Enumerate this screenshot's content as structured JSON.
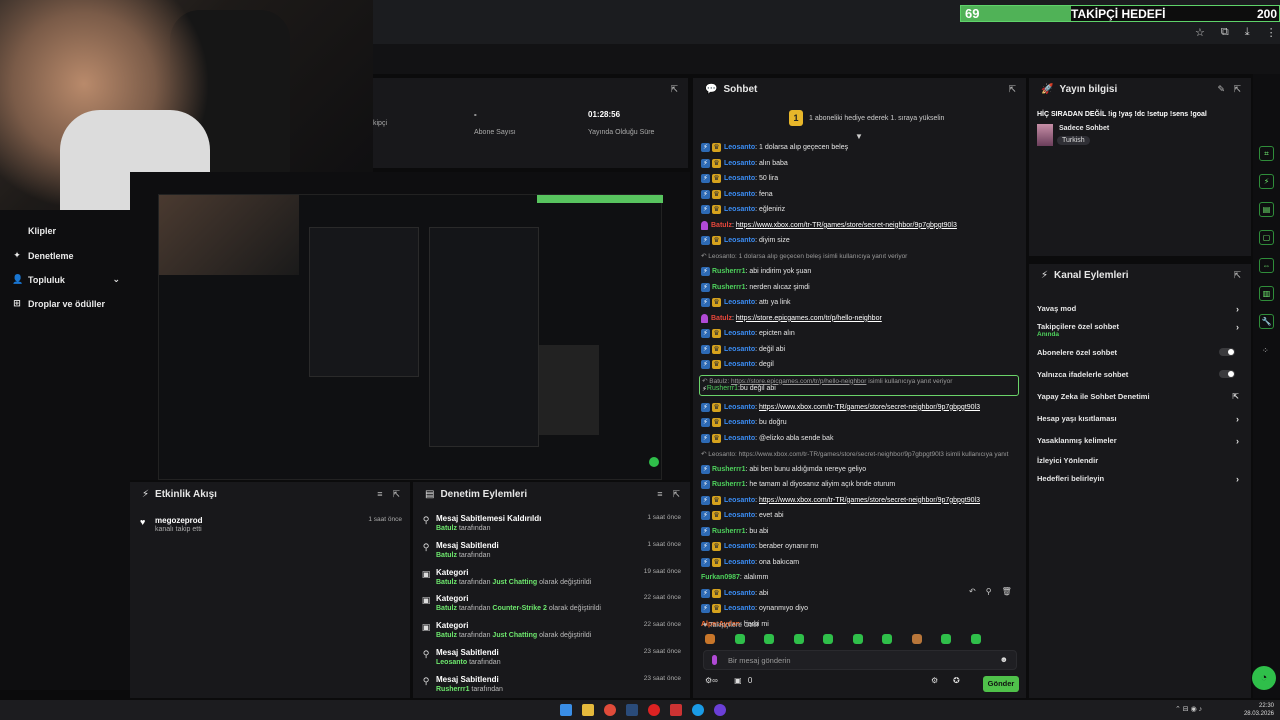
{
  "goal": {
    "current": "69",
    "title": "TAKİPÇİ HEDEFİ",
    "target": "200",
    "progress": 0.345
  },
  "sidebar": {
    "items": [
      {
        "label": "Klipler",
        "icon": ""
      },
      {
        "label": "Denetleme",
        "icon": "✦"
      },
      {
        "label": "Topluluk",
        "icon": "👤"
      },
      {
        "label": "Droplar ve ödüller",
        "icon": "⊞"
      }
    ]
  },
  "stats": {
    "cells": [
      {
        "value": "",
        "label": "kipçi"
      },
      {
        "value": "-",
        "label": "Abone Sayısı"
      },
      {
        "value": "01:28:56",
        "label": "Yayında Olduğu Süre"
      }
    ]
  },
  "activity": {
    "title": "Etkinlik Akışı",
    "items": [
      {
        "name": "megozeprod",
        "desc": "kanalı takip etti",
        "time": "1 saat önce"
      }
    ]
  },
  "moderation": {
    "title": "Denetim Eylemleri",
    "items": [
      {
        "title": "Mesaj Sabitlemesi Kaldırıldı",
        "user": "Batulz",
        "rest": " tarafından",
        "time": "1 saat önce"
      },
      {
        "title": "Mesaj Sabitlendi",
        "user": "Batulz",
        "rest": " tarafından",
        "time": "1 saat önce"
      },
      {
        "title": "Kategori",
        "user": "Batulz",
        "rest": " tarafından ",
        "cat": "Just Chatting",
        "tail": " olarak değiştirildi",
        "time": "19 saat önce"
      },
      {
        "title": "Kategori",
        "user": "Batulz",
        "rest": " tarafından ",
        "cat": "Counter-Strike 2",
        "tail": " olarak değiştirildi",
        "time": "22 saat önce"
      },
      {
        "title": "Kategori",
        "user": "Batulz",
        "rest": " tarafından ",
        "cat": "Just Chatting",
        "tail": " olarak değiştirildi",
        "time": "22 saat önce"
      },
      {
        "title": "Mesaj Sabitlendi",
        "user": "Leosanto",
        "rest": " tarafından",
        "time": "23 saat önce"
      },
      {
        "title": "Mesaj Sabitlendi",
        "user": "Rusherrr1",
        "rest": " tarafından",
        "time": "23 saat önce"
      }
    ]
  },
  "chat": {
    "title": "Sohbet",
    "hype_text": "1 aboneliki hediye ederek 1. sıraya yükselin",
    "hype_rank": "1",
    "input_placeholder": "Bir mesaj gönderin",
    "pinned_label": "Takipçilere Özel",
    "points": "0",
    "send_label": "Gönder",
    "messages": [
      {
        "user": "Leosanto",
        "color": "blue",
        "badges": 2,
        "text": "1 dolarsa alıp geçecen beleş"
      },
      {
        "user": "Leosanto",
        "color": "blue",
        "badges": 2,
        "text": "alın baba"
      },
      {
        "user": "Leosanto",
        "color": "blue",
        "badges": 2,
        "text": "50 lira"
      },
      {
        "user": "Leosanto",
        "color": "blue",
        "badges": 2,
        "text": "fena"
      },
      {
        "user": "Leosanto",
        "color": "blue",
        "badges": 2,
        "text": "eğleniriz"
      },
      {
        "user": "Batulz",
        "color": "red",
        "badges": "p",
        "link": "https://www.xbox.com/tr-TR/games/store/secret-neighbor/9p7gbpgt90l3"
      },
      {
        "user": "Leosanto",
        "color": "blue",
        "badges": 2,
        "text": "diyim size"
      },
      {
        "reply": "Leosanto: 1 dolarsa alıp geçecen beleş isimli kullanıcıya yanıt veriyor"
      },
      {
        "user": "Rusherrr1",
        "color": "green",
        "badges": 1,
        "text": "abi indirim yok şuan"
      },
      {
        "user": "Rusherrr1",
        "color": "green",
        "badges": 1,
        "text": "nerden alıcaz şimdi"
      },
      {
        "user": "Leosanto",
        "color": "blue",
        "badges": 2,
        "text": "attı ya link"
      },
      {
        "user": "Batulz",
        "color": "red",
        "badges": "p",
        "link": "https://store.epicgames.com/tr/p/hello-neighbor"
      },
      {
        "user": "Leosanto",
        "color": "blue",
        "badges": 2,
        "text": "epicten alın"
      },
      {
        "user": "Leosanto",
        "color": "blue",
        "badges": 2,
        "text": "değil abi"
      },
      {
        "user": "Leosanto",
        "color": "blue",
        "badges": 2,
        "text": "degil"
      },
      {
        "highlight": true,
        "reply_user": "Batulz",
        "reply_link": "https://store.epicgames.com/tr/p/hello-neighbor",
        "reply_tail": " isimli kullanıcıya yanıt veriyor",
        "user": "Rusherrr1",
        "color": "green",
        "badges": 1,
        "text": "bu değil abi"
      },
      {
        "user": "Leosanto",
        "color": "blue",
        "badges": 2,
        "link": "https://www.xbox.com/tr-TR/games/store/secret-neighbor/9p7gbpgt90l3"
      },
      {
        "user": "Leosanto",
        "color": "blue",
        "badges": 2,
        "text": "bu doğru"
      },
      {
        "user": "Leosanto",
        "color": "blue",
        "badges": 2,
        "text": "@elizko abla sende bak"
      },
      {
        "reply": "Leosanto: https://www.xbox.com/tr-TR/games/store/secret-neighbor/9p7gbpgt90l3 isimli kullanıcıya yanıt"
      },
      {
        "user": "Rusherrr1",
        "color": "green",
        "badges": 1,
        "text": "abi ben bunu aldığımda nereye geliyo"
      },
      {
        "user": "Rusherrr1",
        "color": "green",
        "badges": 1,
        "text": "he tamam al diyosanız aliyim açık bnde oturum"
      },
      {
        "user": "Leosanto",
        "color": "blue",
        "badges": 2,
        "link": "https://www.xbox.com/tr-TR/games/store/secret-neighbor/9p7gbpgt90l3"
      },
      {
        "user": "Leosanto",
        "color": "blue",
        "badges": 2,
        "text": "evet abi"
      },
      {
        "user": "Rusherrr1",
        "color": "green",
        "badges": 1,
        "text": "bu abi"
      },
      {
        "user": "Leosanto",
        "color": "blue",
        "badges": 2,
        "text": "beraber oynanır mı"
      },
      {
        "user": "Leosanto",
        "color": "blue",
        "badges": 2,
        "text": "ona bakıcam"
      },
      {
        "user": "Furkan0987",
        "color": "green",
        "badges": 0,
        "text": "alalımm"
      },
      {
        "user": "Leosanto",
        "color": "blue",
        "badges": 2,
        "text": "abi"
      },
      {
        "user": "Leosanto",
        "color": "blue",
        "badges": 2,
        "text": "oynanmıyo diyo"
      },
      {
        "user": "AlperAydan",
        "color": "orange",
        "badges": 0,
        "text": "harbi mi"
      }
    ]
  },
  "stream_info": {
    "title": "Yayın bilgisi",
    "stream_title": "HİÇ SIRADAN DEĞİL !ig !yaş !dc !setup !sens !goal",
    "category": "Sadece Sohbet",
    "language": "Turkish"
  },
  "channel_actions": {
    "title": "Kanal Eylemleri",
    "rows": [
      {
        "label": "Yavaş mod",
        "sub": "",
        "control": "chevron"
      },
      {
        "label": "Takipçilere özel sohbet",
        "sub": "Anında",
        "control": "chevron"
      },
      {
        "label": "Abonelere özel sohbet",
        "sub": "",
        "control": "toggle"
      },
      {
        "label": "Yalnızca ifadelerle sohbet",
        "sub": "",
        "control": "toggle"
      },
      {
        "label": "Yapay Zeka ile Sohbet Denetimi",
        "sub": "",
        "control": "external"
      },
      {
        "label": "Hesap yaşı kısıtlaması",
        "sub": "",
        "control": "chevron"
      },
      {
        "label": "Yasaklanmış kelimeler",
        "sub": "",
        "control": "chevron"
      },
      {
        "label": "İzleyici Yönlendir",
        "sub": "",
        "control": "none"
      },
      {
        "label": "Hedefleri belirleyin",
        "sub": "",
        "control": "chevron"
      }
    ]
  },
  "clock": {
    "time": "22:30",
    "date": "28.03.2026"
  },
  "colors": {
    "accent": "#53fc18",
    "panel": "#18181b",
    "link_blue": "#3b8df5"
  }
}
